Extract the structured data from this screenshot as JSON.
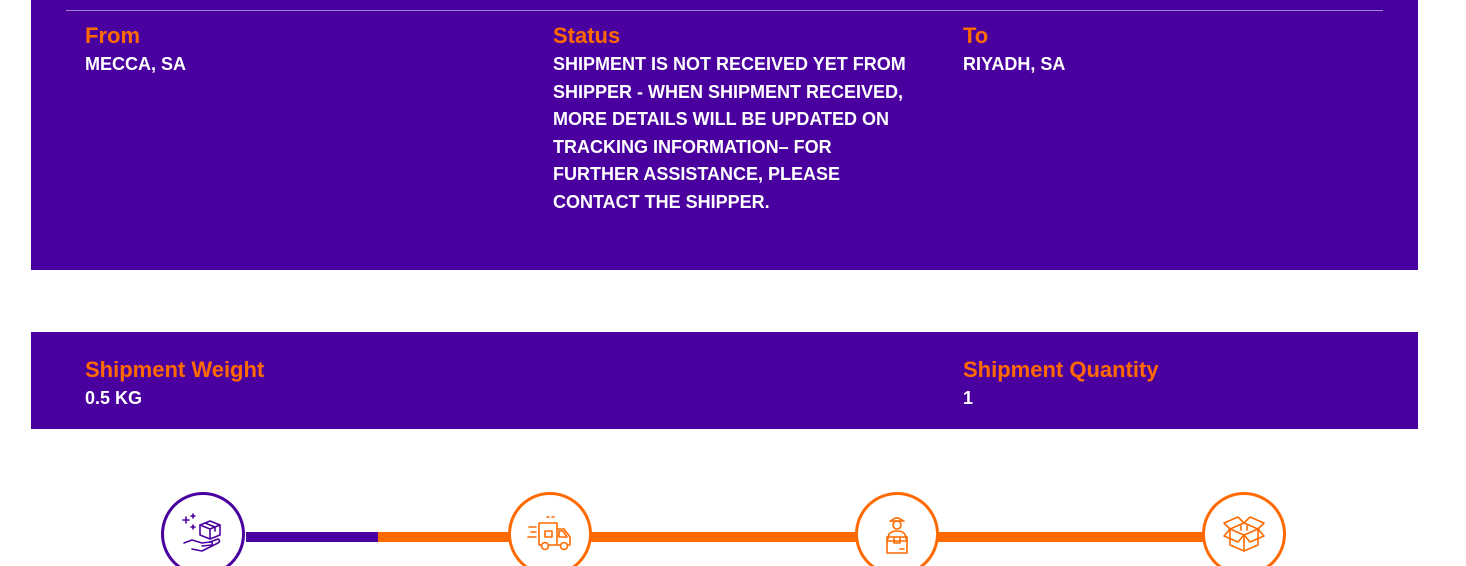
{
  "route": {
    "from": {
      "label": "From",
      "value": "MECCA, SA"
    },
    "status": {
      "label": "Status",
      "value": "SHIPMENT IS NOT RECEIVED YET FROM SHIPPER - WHEN SHIPMENT RECEIVED, MORE DETAILS WILL BE UPDATED ON TRACKING INFORMATION– FOR FURTHER ASSISTANCE, PLEASE CONTACT THE SHIPPER."
    },
    "to": {
      "label": "To",
      "value": "RIYADH, SA"
    }
  },
  "details": {
    "weight": {
      "label": "Shipment Weight",
      "value": "0.5 KG"
    },
    "quantity": {
      "label": "Shipment Quantity",
      "value": "1"
    }
  },
  "timeline": {
    "current_step": 1,
    "total_steps": 4,
    "steps": [
      {
        "icon": "package-in-hand-icon"
      },
      {
        "icon": "delivery-truck-icon"
      },
      {
        "icon": "courier-with-box-icon"
      },
      {
        "icon": "open-box-icon"
      }
    ]
  },
  "colors": {
    "brand_purple": "#4a009f",
    "accent_orange": "#ff6a00",
    "text_white": "#ffffff"
  }
}
